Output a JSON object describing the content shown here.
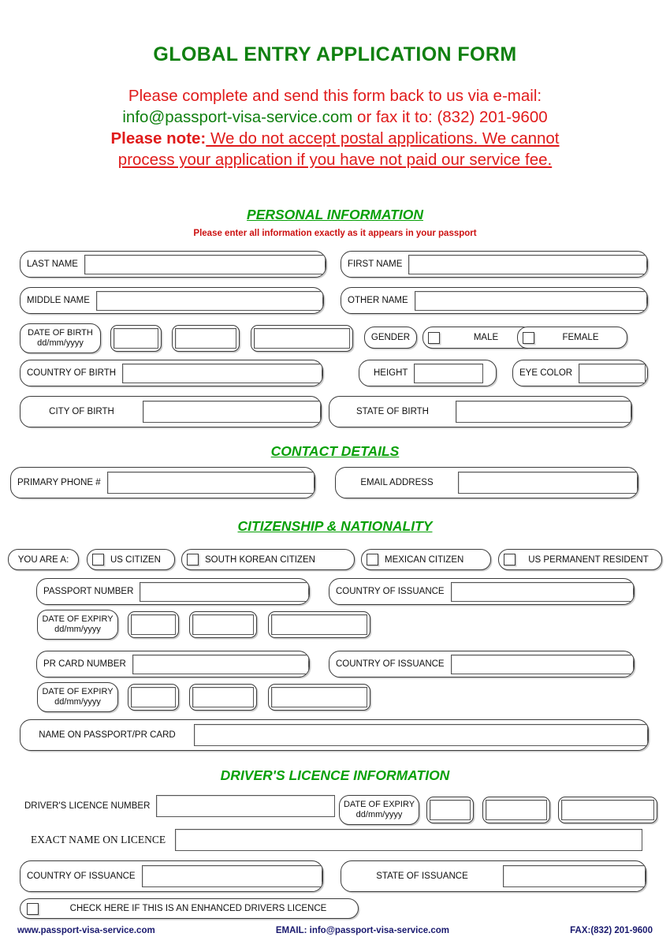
{
  "header": {
    "title": "GLOBAL ENTRY APPLICATION FORM",
    "line1": "Please complete and send this form back to us via e-mail:",
    "email": "info@passport-visa-service.com",
    "line2_tail": " or fax it to:  (832) 201-9600",
    "note_label": "Please note:",
    "note_line1": " We do not accept postal applications. We cannot",
    "note_line2": "process your application if you have not paid our service fee."
  },
  "colors": {
    "title_green": "#108010",
    "section_green": "#09a009",
    "red": "#e01b1b",
    "footer_navy": "#19196e"
  },
  "sections": {
    "personal": "PERSONAL INFORMATION",
    "personal_note": "Please enter all information exactly as it appears in your passport",
    "contact": "CONTACT DETAILS",
    "citizenship": "CITIZENSHIP & NATIONALITY",
    "drivers": "DRIVER'S LICENCE INFORMATION"
  },
  "personal": {
    "last_name": "LAST NAME",
    "first_name": "FIRST NAME",
    "middle_name": "MIDDLE NAME",
    "other_name": "OTHER NAME",
    "date_of_birth": "DATE OF BIRTH",
    "date_format": "dd/mm/yyyy",
    "gender": "GENDER",
    "male": "MALE",
    "female": "FEMALE",
    "country_of_birth": "COUNTRY OF BIRTH",
    "height": "HEIGHT",
    "eye_color": "EYE COLOR",
    "city_of_birth": "CITY OF BIRTH",
    "state_of_birth": "STATE OF BIRTH"
  },
  "contact": {
    "primary_phone": "PRIMARY PHONE #",
    "email_address": "EMAIL ADDRESS"
  },
  "citizenship": {
    "you_are_a": "YOU ARE A:",
    "options": [
      "US CITIZEN",
      "SOUTH KOREAN CITIZEN",
      "MEXICAN CITIZEN",
      "US PERMANENT RESIDENT"
    ],
    "passport_number": "PASSPORT NUMBER",
    "country_of_issuance": "COUNTRY OF ISSUANCE",
    "date_of_expiry": "DATE OF EXPIRY",
    "date_format": "dd/mm/yyyy",
    "pr_card_number": "PR CARD NUMBER",
    "pr_country_of_issuance": "COUNTRY OF ISSUANCE",
    "pr_date_of_expiry": "DATE OF EXPIRY",
    "name_on_passport": "NAME ON PASSPORT/PR CARD"
  },
  "drivers": {
    "licence_number": "DRIVER'S LICENCE NUMBER",
    "date_of_expiry": "DATE OF EXPIRY",
    "date_format": "dd/mm/yyyy",
    "exact_name": "EXACT NAME ON LICENCE",
    "country_of_issuance": "COUNTRY OF ISSUANCE",
    "state_of_issuance": "STATE OF ISSUANCE",
    "enhanced_checkbox": "CHECK HERE IF THIS IS AN ENHANCED DRIVERS LICENCE"
  },
  "footer": {
    "website": "www.passport-visa-service.com",
    "email": "EMAIL: info@passport-visa-service.com",
    "fax": "FAX:(832) 201-9600"
  }
}
